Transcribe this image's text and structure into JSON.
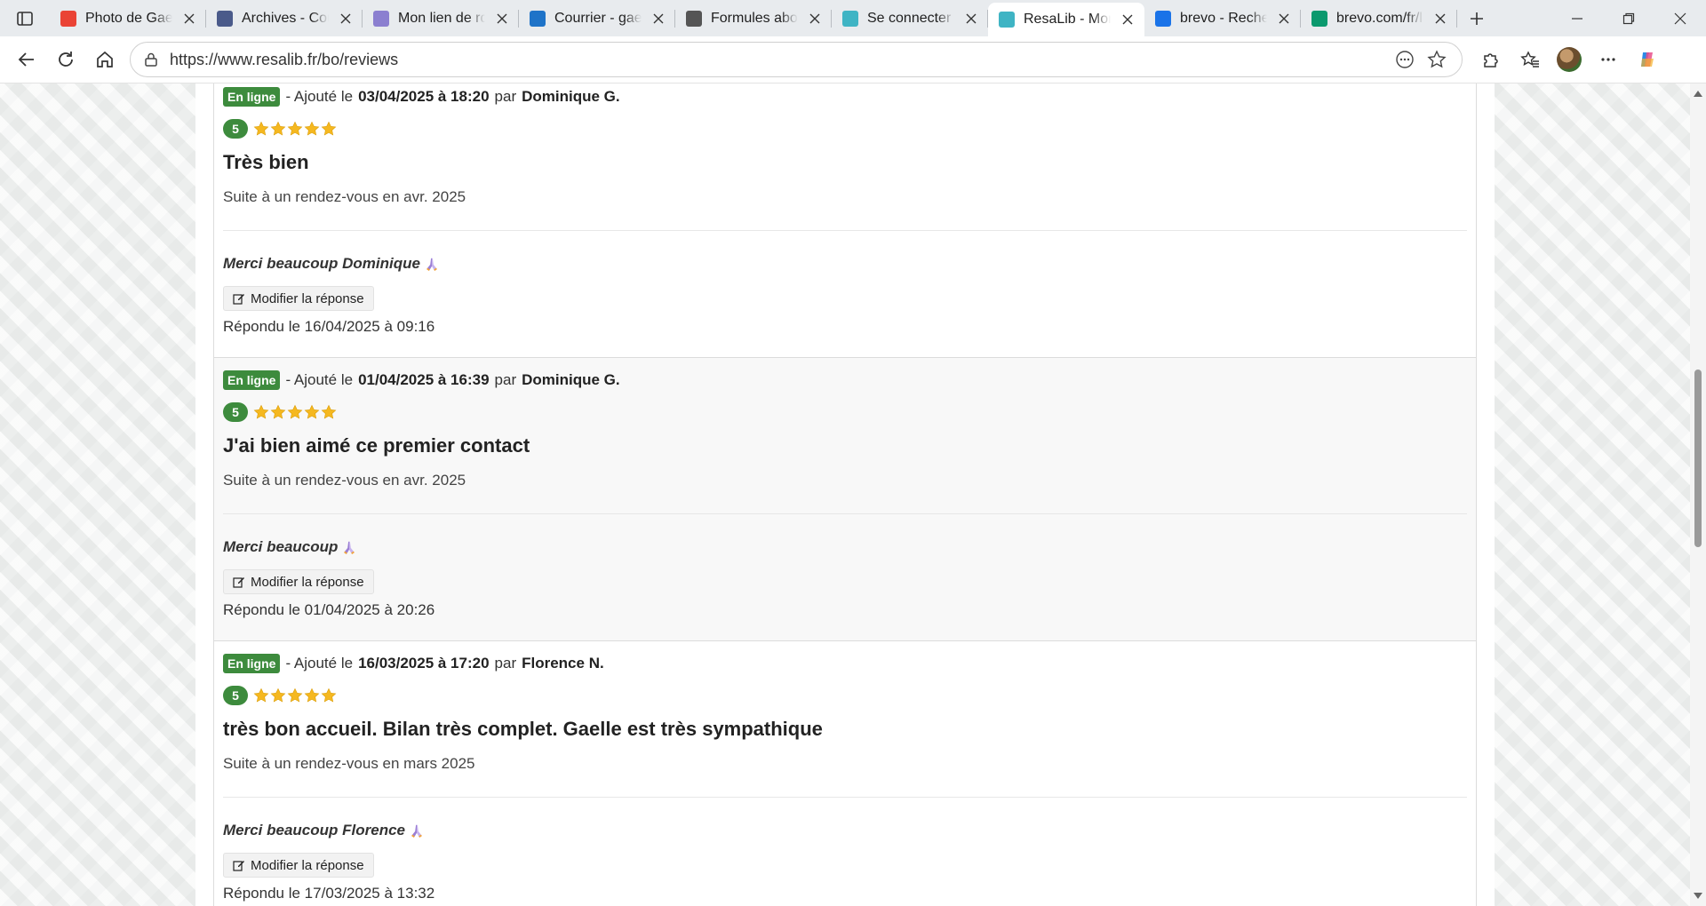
{
  "browser": {
    "tabs": [
      {
        "title": "Photo de Gaelle",
        "icon": "gmail-icon",
        "color": "#ea4335"
      },
      {
        "title": "Archives - Courrier",
        "icon": "archives-icon",
        "color": "#4a5a8a"
      },
      {
        "title": "Mon lien de rdv",
        "icon": "booking-icon",
        "color": "#8b7fd0"
      },
      {
        "title": "Courrier - gaelle",
        "icon": "outlook-icon",
        "color": "#1e73c8"
      },
      {
        "title": "Formules abonnement",
        "icon": "openai-icon",
        "color": "#555555"
      },
      {
        "title": "Se connecter | ResaLib",
        "icon": "resalib-icon",
        "color": "#3fb4c4"
      },
      {
        "title": "ResaLib - Mon compte",
        "icon": "resalib-icon",
        "color": "#3fb4c4",
        "active": true
      },
      {
        "title": "brevo - Rechercher",
        "icon": "search-icon",
        "color": "#1a73e8"
      },
      {
        "title": "brevo.com/fr/landing",
        "icon": "brevo-icon",
        "color": "#0b996e"
      }
    ],
    "url": "https://www.resalib.fr/bo/reviews"
  },
  "reviews": [
    {
      "status": "En ligne",
      "added_prefix": "- Ajouté le",
      "date": "03/04/2025 à 18:20",
      "by": "par",
      "author": "Dominique G.",
      "rating": "5",
      "stars": 5,
      "title": "Très bien",
      "context": "Suite à un rendez-vous en avr. 2025",
      "reply": "Merci beaucoup Dominique",
      "edit_label": "Modifier la réponse",
      "answered": "Répondu le 16/04/2025 à 09:16"
    },
    {
      "status": "En ligne",
      "added_prefix": "- Ajouté le",
      "date": "01/04/2025 à 16:39",
      "by": "par",
      "author": "Dominique G.",
      "rating": "5",
      "stars": 5,
      "title": "J'ai bien aimé ce premier contact",
      "context": "Suite à un rendez-vous en avr. 2025",
      "reply": "Merci beaucoup",
      "edit_label": "Modifier la réponse",
      "answered": "Répondu le 01/04/2025 à 20:26"
    },
    {
      "status": "En ligne",
      "added_prefix": "- Ajouté le",
      "date": "16/03/2025 à 17:20",
      "by": "par",
      "author": "Florence N.",
      "rating": "5",
      "stars": 5,
      "title": "très bon accueil. Bilan très complet. Gaelle est très sympathique",
      "context": "Suite à un rendez-vous en mars 2025",
      "reply": "Merci beaucoup Florence",
      "edit_label": "Modifier la réponse",
      "answered": "Répondu le 17/03/2025 à 13:32"
    }
  ],
  "colors": {
    "status_green": "#3d8b3d",
    "star": "#f5b820"
  }
}
